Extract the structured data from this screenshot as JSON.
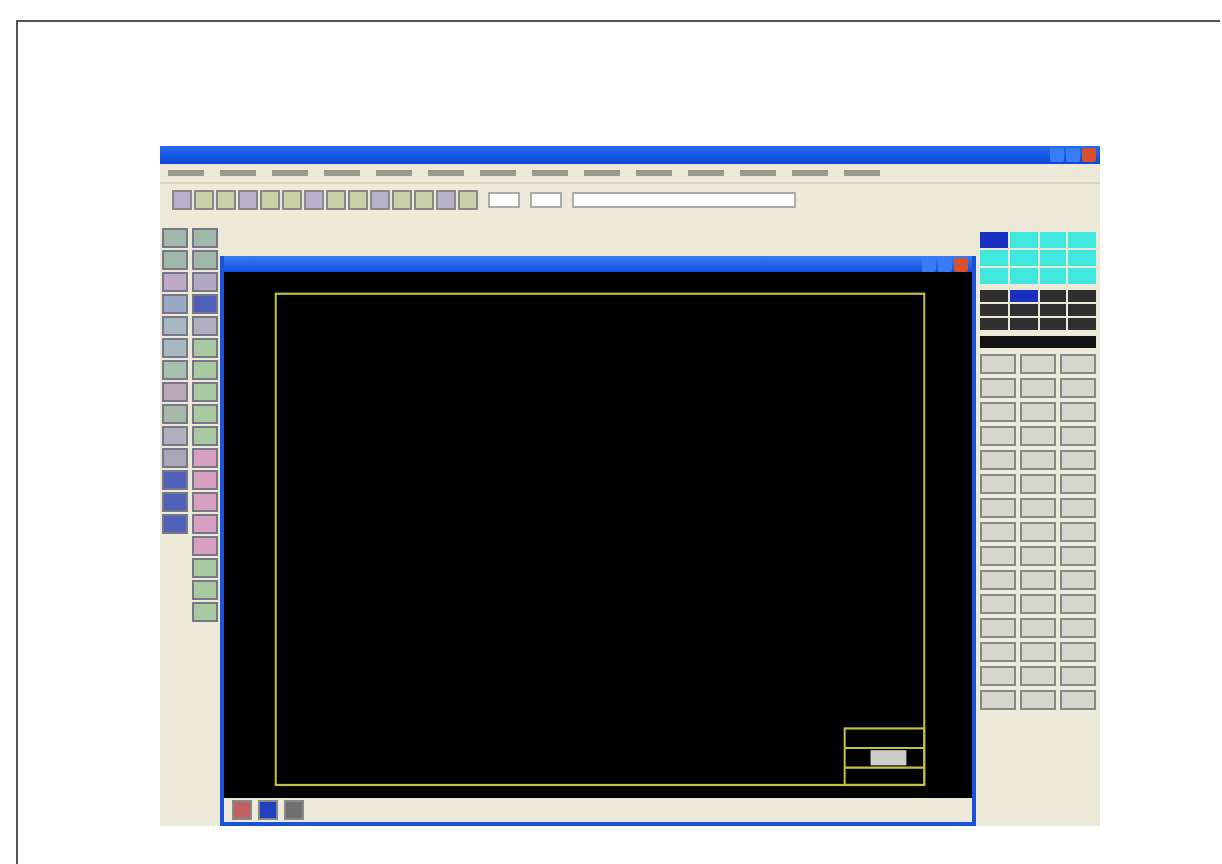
{
  "left_tools_a": [
    {
      "color": "#9fb8a8"
    },
    {
      "color": "#9fb8a8"
    },
    {
      "color": "#c0a8c8"
    },
    {
      "color": "#9aa8c8"
    },
    {
      "color": "#a8b8c0"
    },
    {
      "color": "#a8b8c0"
    },
    {
      "color": "#a8c0b0"
    },
    {
      "color": "#b8a8b8"
    },
    {
      "color": "#a8b8a8"
    },
    {
      "color": "#b0b0c0"
    },
    {
      "color": "#a8a8b8"
    },
    {
      "color": "#5060b8"
    },
    {
      "color": "#5060b8"
    },
    {
      "color": "#5060b8"
    }
  ],
  "left_tools_b": [
    {
      "color": "#9fb8a8"
    },
    {
      "color": "#9fb8a8"
    },
    {
      "color": "#b0a8c0"
    },
    {
      "color": "#5060b8"
    },
    {
      "color": "#b0b0c0"
    },
    {
      "color": "#a8c8a0"
    },
    {
      "color": "#a8c8a0"
    },
    {
      "color": "#a8c8a0"
    },
    {
      "color": "#a8c8a0"
    },
    {
      "color": "#a8c8a0"
    },
    {
      "color": "#d8a0c0"
    },
    {
      "color": "#d8a0c0"
    },
    {
      "color": "#d8a0c0"
    },
    {
      "color": "#d8a0c0"
    },
    {
      "color": "#d8a0c0"
    },
    {
      "color": "#a8c8a0"
    },
    {
      "color": "#a8c8a0"
    },
    {
      "color": "#a8c8a0"
    }
  ],
  "layer_palette": [
    {
      "selected": true
    },
    {
      "selected": false
    },
    {
      "selected": false
    },
    {
      "selected": false
    },
    {
      "selected": false
    },
    {
      "selected": false
    },
    {
      "selected": false
    },
    {
      "selected": false
    },
    {
      "selected": false
    },
    {
      "selected": false
    },
    {
      "selected": false
    },
    {
      "selected": false
    }
  ],
  "color_palette": [
    {
      "selected": false
    },
    {
      "selected": true
    },
    {
      "selected": false
    },
    {
      "selected": false
    },
    {
      "selected": false
    },
    {
      "selected": false
    },
    {
      "selected": false
    },
    {
      "selected": false
    },
    {
      "selected": false
    },
    {
      "selected": false
    },
    {
      "selected": false
    },
    {
      "selected": false
    }
  ]
}
